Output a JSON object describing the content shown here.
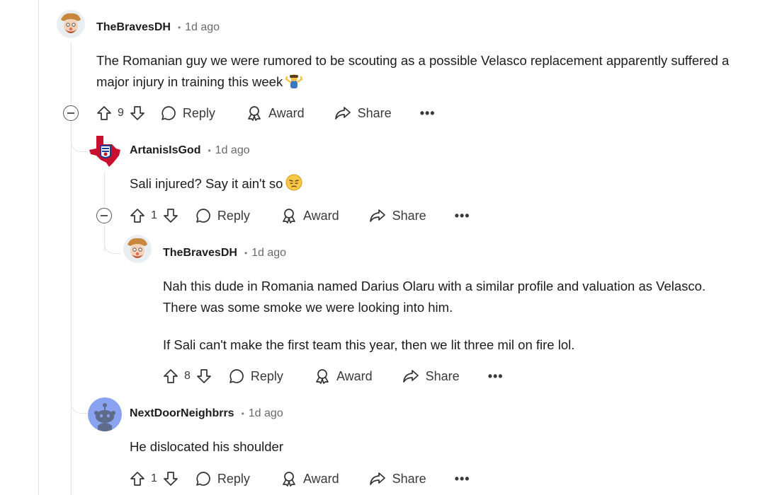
{
  "comments": [
    {
      "username": "TheBravesDH",
      "time": "1d ago",
      "paragraphs": [
        "The Romanian guy we were rumored to be scouting as a possible Velasco replacement apparently suffered a major injury in training this week"
      ],
      "emoji": "person-shrugging",
      "votes": "9",
      "reply_label": "Reply",
      "award_label": "Award",
      "share_label": "Share",
      "more_label": "•••"
    },
    {
      "username": "ArtanisIsGod",
      "time": "1d ago",
      "paragraphs": [
        "Sali injured? Say it ain't so"
      ],
      "emoji": "pensive-face",
      "votes": "1",
      "reply_label": "Reply",
      "award_label": "Award",
      "share_label": "Share",
      "more_label": "•••"
    },
    {
      "username": "TheBravesDH",
      "time": "1d ago",
      "paragraphs": [
        "Nah this dude in Romania named Darius Olaru with a similar profile and valuation as Velasco. There was some smoke we were looking into him.",
        "If Sali can't make the first team this year, then we lit three mil on fire lol."
      ],
      "votes": "8",
      "reply_label": "Reply",
      "award_label": "Award",
      "share_label": "Share",
      "more_label": "•••"
    },
    {
      "username": "NextDoorNeighbrrs",
      "time": "1d ago",
      "paragraphs": [
        "He dislocated his shoulder"
      ],
      "votes": "1",
      "reply_label": "Reply",
      "award_label": "Award",
      "share_label": "Share",
      "more_label": "•••"
    }
  ],
  "separator": "•",
  "colors": {
    "text": "#1c1c1c",
    "meta": "#6a6a6a",
    "line": "#e1e4e8",
    "snoo_bg": "#8aa3f0"
  }
}
